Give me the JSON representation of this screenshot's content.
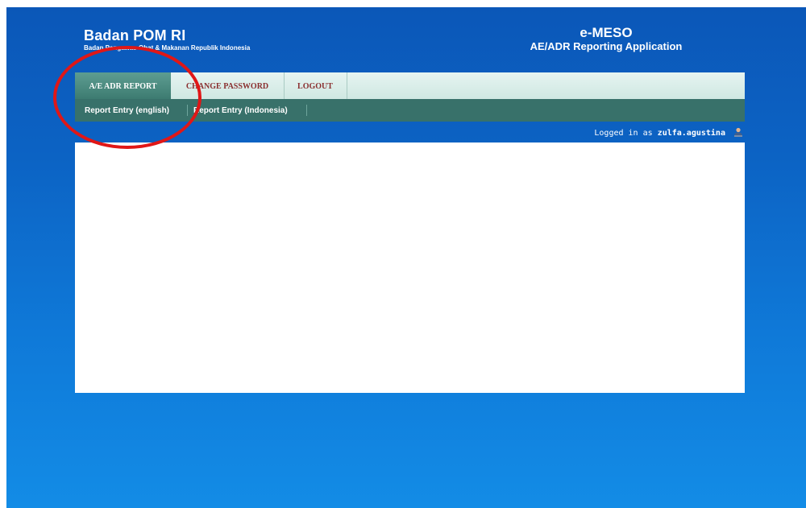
{
  "header": {
    "org_title": "Badan POM RI",
    "org_subtitle": "Badan Pengawas Obat & Makanan Republik Indonesia",
    "app_title": "e-MESO",
    "app_subtitle": "AE/ADR Reporting Application"
  },
  "nav": {
    "tabs": [
      {
        "label": "A/E ADR REPORT",
        "active": true
      },
      {
        "label": "CHANGE PASSWORD",
        "active": false
      },
      {
        "label": "LOGOUT",
        "active": false
      }
    ],
    "subnav": [
      {
        "label": "Report Entry (english)"
      },
      {
        "label": "Report Entry (Indonesia)"
      }
    ]
  },
  "status": {
    "logged_in_prefix": "Logged in as",
    "username": "zulfa.agustina",
    "icon": "user-icon"
  },
  "annotation": {
    "highlight_color": "#e01717"
  },
  "colors": {
    "background_top": "#0b57b8",
    "background_bottom": "#138ce6",
    "active_tab": "#3d7b71",
    "subnav": "#38716a",
    "inactive_tab_text": "#8a2f2f"
  }
}
